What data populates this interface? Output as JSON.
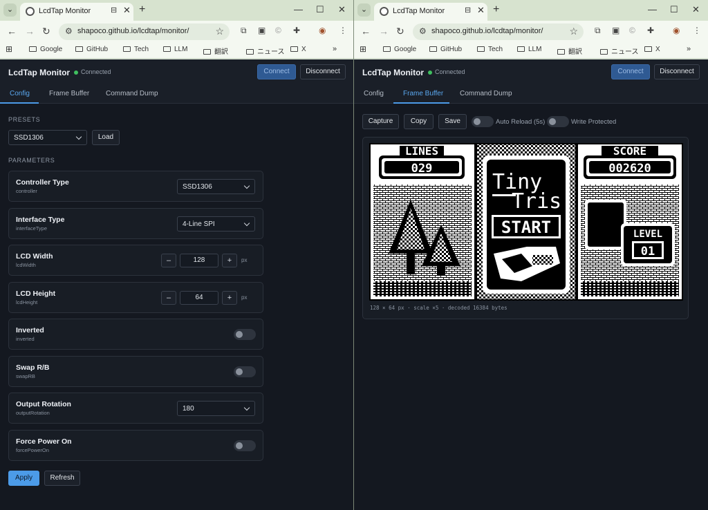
{
  "browser": {
    "tab_title": "LcdTap Monitor",
    "url": "shapoco.github.io/lcdtap/monitor/",
    "bookmarks": [
      "Google",
      "GitHub",
      "Tech",
      "LLM",
      "翻訳",
      "ニュース",
      "X"
    ],
    "bookmark_overflow": "»"
  },
  "app": {
    "title": "LcdTap Monitor",
    "status": "Connected",
    "connect_label": "Connect",
    "disconnect_label": "Disconnect",
    "tabs": [
      "Config",
      "Frame Buffer",
      "Command Dump"
    ]
  },
  "config": {
    "presets_label": "PRESETS",
    "preset_value": "SSD1306",
    "load_label": "Load",
    "parameters_label": "PARAMETERS",
    "params": [
      {
        "name": "Controller Type",
        "key": "controller",
        "value": "SSD1306"
      },
      {
        "name": "Interface Type",
        "key": "interfaceType",
        "value": "4-Line SPI"
      },
      {
        "name": "LCD Width",
        "key": "lcdWidth",
        "value": "128",
        "unit": "px",
        "minus": "–",
        "plus": "+"
      },
      {
        "name": "LCD Height",
        "key": "lcdHeight",
        "value": "64",
        "unit": "px",
        "minus": "–",
        "plus": "+"
      },
      {
        "name": "Inverted",
        "key": "inverted",
        "on": false
      },
      {
        "name": "Swap R/B",
        "key": "swapRB",
        "on": false
      },
      {
        "name": "Output Rotation",
        "key": "outputRotation",
        "value": "180"
      },
      {
        "name": "Force Power On",
        "key": "forcePowerOn",
        "on": false
      }
    ],
    "apply_label": "Apply",
    "refresh_label": "Refresh"
  },
  "framebuffer": {
    "capture_label": "Capture",
    "copy_label": "Copy",
    "save_label": "Save",
    "auto_reload_label": "Auto Reload (5s)",
    "auto_reload_on": false,
    "write_protected_label": "Write Protected",
    "write_protected_on": false,
    "lines_label": "LINES",
    "lines_value": "029",
    "score_label": "SCORE",
    "score_value": "002620",
    "game_title_1": "Tiny",
    "game_title_2": "Tris",
    "start_label": "START",
    "level_label": "LEVEL",
    "level_value": "01",
    "caption": "128 × 64 px · scale ×5 · decoded 16384 bytes"
  },
  "colors": {
    "accent": "#4c9be8",
    "primary_button": "#2f5a93",
    "connected": "#3fbf5f",
    "app_bg": "#141820"
  }
}
